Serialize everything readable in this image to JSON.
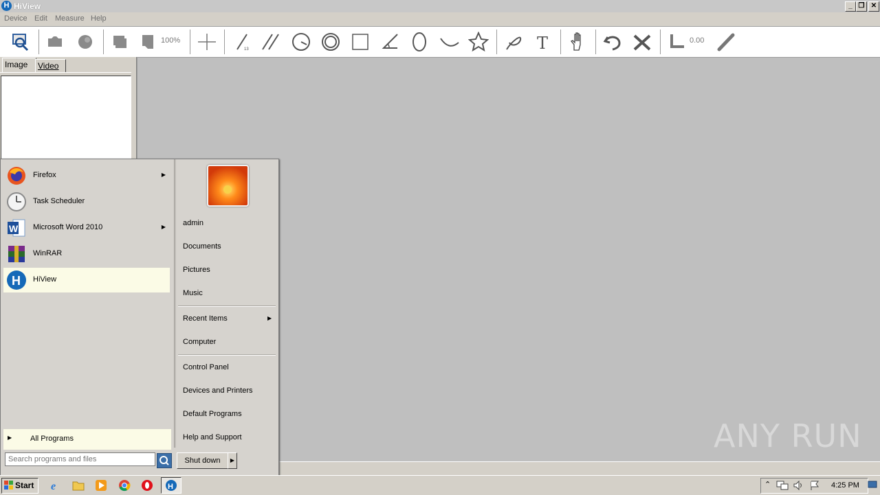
{
  "window": {
    "title": "HiView",
    "app_icon_letter": "H",
    "min_glyph": "_",
    "restore_glyph": "❐",
    "close_glyph": "✕"
  },
  "menu": [
    "Device",
    "Edit",
    "Measure",
    "Help"
  ],
  "toolbar": {
    "zoom_text": "100%",
    "angle_value": "0.00"
  },
  "left_panel": {
    "tabs": [
      "Image",
      "Video"
    ]
  },
  "watermark": "ANY RUN",
  "start_menu": {
    "programs": [
      {
        "label": "Firefox",
        "icon": "firefox-icon",
        "has_submenu": true
      },
      {
        "label": "Task Scheduler",
        "icon": "clock-icon",
        "has_submenu": false
      },
      {
        "label": "Microsoft Word 2010",
        "icon": "word-icon",
        "has_submenu": true
      },
      {
        "label": "WinRAR",
        "icon": "winrar-icon",
        "has_submenu": false
      },
      {
        "label": "HiView",
        "icon": "hiview-icon",
        "has_submenu": false
      }
    ],
    "all_programs": "All Programs",
    "search_placeholder": "Search programs and files",
    "shutdown": "Shut down",
    "right_items": {
      "user": "admin",
      "documents": "Documents",
      "pictures": "Pictures",
      "music": "Music",
      "recent": "Recent Items",
      "computer": "Computer",
      "control_panel": "Control Panel",
      "devices": "Devices and Printers",
      "defaults": "Default Programs",
      "help": "Help and Support"
    }
  },
  "taskbar": {
    "start_label": "Start",
    "clock": "4:25 PM",
    "pinned": [
      "internet-explorer-icon",
      "explorer-folder-icon",
      "media-player-icon",
      "chrome-icon",
      "opera-icon",
      "hiview-icon"
    ]
  },
  "colors": {
    "canvas_bg": "#bfbfbf",
    "chrome_bg": "#d4d0c8",
    "highlight": "#fbfbe6",
    "hiview_blue": "#1569b8"
  }
}
